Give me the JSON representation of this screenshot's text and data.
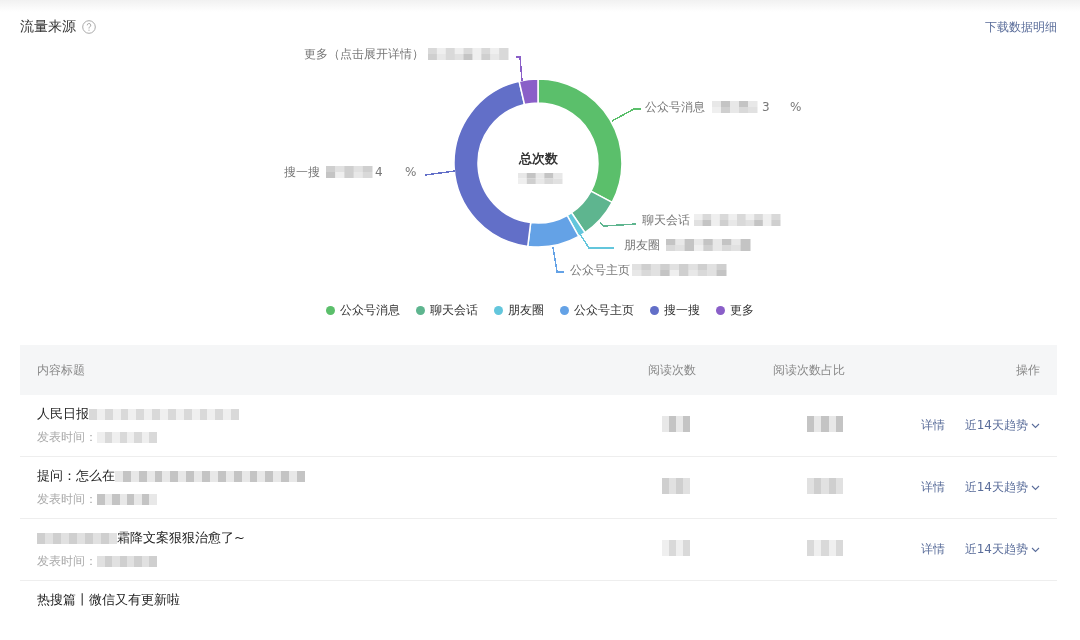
{
  "panel": {
    "title": "流量来源",
    "download_link": "下载数据明细",
    "chart": {
      "center_title": "总次数",
      "slice_labels": [
        {
          "name": "更多（点击展开详情）",
          "color": "#8a5fc8"
        },
        {
          "name": "公众号消息",
          "percent_lead": "3",
          "percent_unit": "%",
          "color": "#5bbf6b"
        },
        {
          "name": "搜一搜",
          "percent_lead": "4",
          "percent_unit": "%",
          "color": "#626fc8"
        },
        {
          "name": "聊天会话",
          "color": "#5eb58f"
        },
        {
          "name": "朋友圈",
          "color": "#63c6dc"
        },
        {
          "name": "公众号主页",
          "color": "#64a2e6"
        }
      ]
    },
    "legend": [
      {
        "label": "公众号消息",
        "color": "#5bbf6b"
      },
      {
        "label": "聊天会话",
        "color": "#5eb58f"
      },
      {
        "label": "朋友圈",
        "color": "#63c6dc"
      },
      {
        "label": "公众号主页",
        "color": "#64a2e6"
      },
      {
        "label": "搜一搜",
        "color": "#626fc8"
      },
      {
        "label": "更多",
        "color": "#8a5fc8"
      }
    ]
  },
  "table": {
    "columns": [
      "内容标题",
      "阅读次数",
      "阅读次数占比",
      "操作"
    ],
    "rows": [
      {
        "kind": "text-then-blur",
        "title": "人民日报",
        "published_label": "发表时间：",
        "actions": [
          "详情",
          "近14天趋势"
        ]
      },
      {
        "kind": "text-then-blur",
        "title": "提问：怎么在",
        "published_label": "发表时间：",
        "actions": [
          "详情",
          "近14天趋势"
        ]
      },
      {
        "kind": "blur-then-text",
        "title": "霜降文案狠狠治愈了~",
        "published_label": "发表时间：",
        "actions": [
          "详情",
          "近14天趋势"
        ]
      },
      {
        "kind": "text-only",
        "title": "热搜篇丨微信又有更新啦"
      }
    ]
  }
}
